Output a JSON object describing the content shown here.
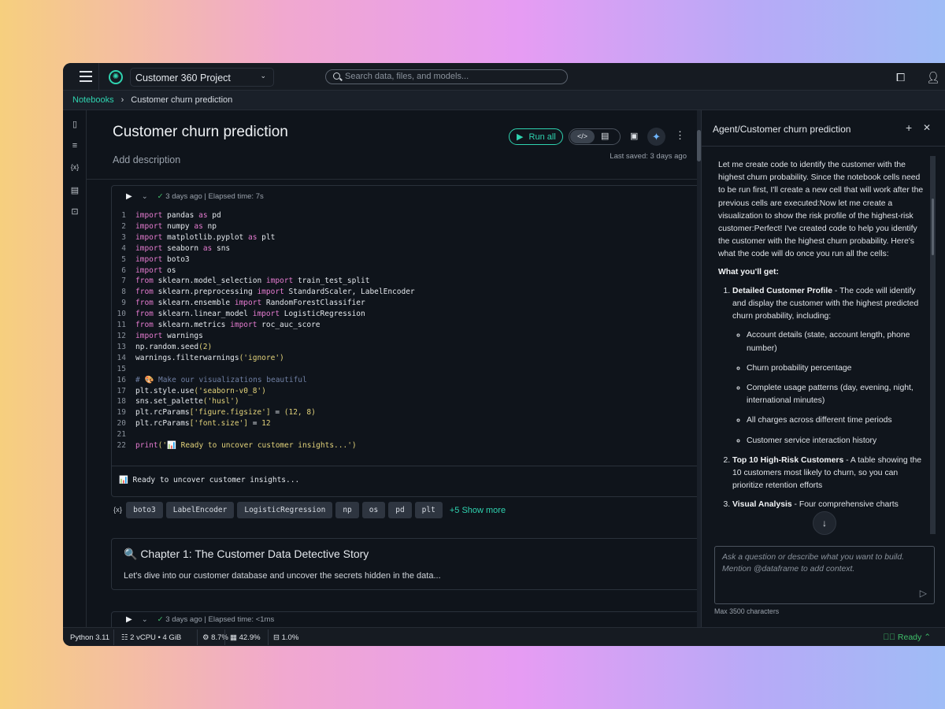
{
  "topbar": {
    "project": "Customer 360 Project",
    "search_placeholder": "Search data, files, and models..."
  },
  "breadcrumb": {
    "root": "Notebooks",
    "current": "Customer churn prediction"
  },
  "notebook": {
    "title": "Customer churn prediction",
    "description_placeholder": "Add description",
    "run_all": "Run all",
    "last_saved": "Last saved: 3 days ago"
  },
  "cell1": {
    "status": "3 days ago | Elapsed time: 7s",
    "code": [
      [
        [
          "kw",
          "import"
        ],
        [
          "tx",
          " pandas "
        ],
        [
          "kw",
          "as"
        ],
        [
          "tx",
          " pd"
        ]
      ],
      [
        [
          "kw",
          "import"
        ],
        [
          "tx",
          " numpy "
        ],
        [
          "kw",
          "as"
        ],
        [
          "tx",
          " np"
        ]
      ],
      [
        [
          "kw",
          "import"
        ],
        [
          "tx",
          " matplotlib.pyplot "
        ],
        [
          "kw",
          "as"
        ],
        [
          "tx",
          " plt"
        ]
      ],
      [
        [
          "kw",
          "import"
        ],
        [
          "tx",
          " seaborn "
        ],
        [
          "kw",
          "as"
        ],
        [
          "tx",
          " sns"
        ]
      ],
      [
        [
          "kw",
          "import"
        ],
        [
          "tx",
          " boto3"
        ]
      ],
      [
        [
          "kw",
          "import"
        ],
        [
          "tx",
          " os"
        ]
      ],
      [
        [
          "kw",
          "from"
        ],
        [
          "tx",
          " sklearn.model_selection "
        ],
        [
          "kw",
          "import"
        ],
        [
          "tx",
          " train_test_split"
        ]
      ],
      [
        [
          "kw",
          "from"
        ],
        [
          "tx",
          " sklearn.preprocessing "
        ],
        [
          "kw",
          "import"
        ],
        [
          "tx",
          " StandardScaler, LabelEncoder"
        ]
      ],
      [
        [
          "kw",
          "from"
        ],
        [
          "tx",
          " sklearn.ensemble "
        ],
        [
          "kw",
          "import"
        ],
        [
          "tx",
          " RandomForestClassifier"
        ]
      ],
      [
        [
          "kw",
          "from"
        ],
        [
          "tx",
          " sklearn.linear_model "
        ],
        [
          "kw",
          "import"
        ],
        [
          "tx",
          " LogisticRegression"
        ]
      ],
      [
        [
          "kw",
          "from"
        ],
        [
          "tx",
          " sklearn.metrics "
        ],
        [
          "kw",
          "import"
        ],
        [
          "tx",
          " roc_auc_score"
        ]
      ],
      [
        [
          "kw",
          "import"
        ],
        [
          "tx",
          " warnings"
        ]
      ],
      [
        [
          "tx",
          "np.random.seed"
        ],
        [
          "str",
          "(2)"
        ]
      ],
      [
        [
          "tx",
          "warnings.filterwarnings"
        ],
        [
          "str",
          "('ignore')"
        ]
      ],
      [],
      [
        [
          "cm",
          "# 🎨 Make our visualizations beautiful"
        ]
      ],
      [
        [
          "tx",
          "plt.style.use"
        ],
        [
          "str",
          "('seaborn-v0_8')"
        ]
      ],
      [
        [
          "tx",
          "sns.set_palette"
        ],
        [
          "str",
          "('husl')"
        ]
      ],
      [
        [
          "tx",
          "plt.rcParams"
        ],
        [
          "str",
          "['figure.figsize']"
        ],
        [
          "tx",
          " = "
        ],
        [
          "str",
          "(12, 8)"
        ]
      ],
      [
        [
          "tx",
          "plt.rcParams"
        ],
        [
          "str",
          "['font.size']"
        ],
        [
          "tx",
          " = "
        ],
        [
          "str",
          "12"
        ]
      ],
      [],
      [
        [
          "kw",
          "print"
        ],
        [
          "str",
          "('📊 Ready to uncover customer insights...')"
        ]
      ]
    ],
    "output": "📊 Ready to uncover customer insights...",
    "variables": [
      "boto3",
      "LabelEncoder",
      "LogisticRegression",
      "np",
      "os",
      "pd",
      "plt"
    ],
    "show_more": "+5 Show more"
  },
  "markdown": {
    "heading": "🔍 Chapter 1: The Customer Data Detective Story",
    "text": "Let's dive into our customer database and uncover the secrets hidden in the data..."
  },
  "cell2": {
    "status": "3 days ago | Elapsed time: <1ms"
  },
  "agent": {
    "title": "Agent/Customer churn prediction",
    "intro": "Let me create code to identify the customer with the highest churn probability. Since the notebook cells need to be run first, I'll create a new cell that will work after the previous cells are executed:Now let me create a visualization to show the risk profile of the highest-risk customer:Perfect! I've created code to help you identify the customer with the highest churn probability. Here's what the code will do once you run all the cells:",
    "what_heading": "What you'll get:",
    "items": [
      {
        "title": "Detailed Customer Profile",
        "text": " - The code will identify and display the customer with the highest predicted churn probability, including:",
        "bullets": [
          "Account details (state, account length, phone number)",
          "Churn probability percentage",
          "Complete usage patterns (day, evening, night, international minutes)",
          "All charges across different time periods",
          "Customer service interaction history"
        ]
      },
      {
        "title": "Top 10 High-Risk Customers",
        "text": " - A table showing the 10 customers most likely to churn, so you can prioritize retention efforts"
      },
      {
        "title": "Visual Analysis",
        "text": " - Four comprehensive charts"
      }
    ],
    "input_placeholder": "Ask a question or describe what you want to build. Mention @dataframe to add context.",
    "max_chars": "Max 3500 characters"
  },
  "statusbar": {
    "kernel": "Python 3.11",
    "compute": "2 vCPU • 4 GiB",
    "cpu": "8.7%",
    "memory": "42.9%",
    "disk": "1.0%",
    "state": "Ready"
  },
  "colors": {
    "accent": "#2fd3b0",
    "ready": "#3fbf6a",
    "keyword": "#e57bd0",
    "string": "#e2d27a"
  }
}
